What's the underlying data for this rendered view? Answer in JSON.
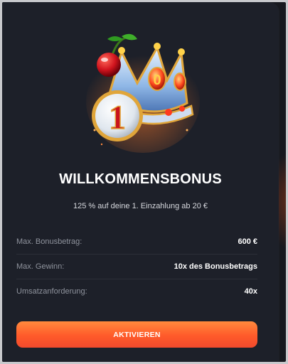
{
  "promo": {
    "title": "WILLKOMMENSBONUS",
    "subtitle": "125 % auf deine 1. Einzahlung ab 20 €",
    "coin_number": "1",
    "crown_number": "0"
  },
  "details": [
    {
      "label": "Max. Bonusbetrag:",
      "value": "600 €"
    },
    {
      "label": "Max. Gewinn:",
      "value": "10x des Bonusbetrags"
    },
    {
      "label": "Umsatzanforderung:",
      "value": "40x"
    }
  ],
  "cta": {
    "label": "AKTIVIEREN"
  },
  "colors": {
    "card": "#1d2029",
    "button_top": "#ff8a3d",
    "button_bottom": "#f24a2c",
    "divider": "#2c2f38"
  }
}
